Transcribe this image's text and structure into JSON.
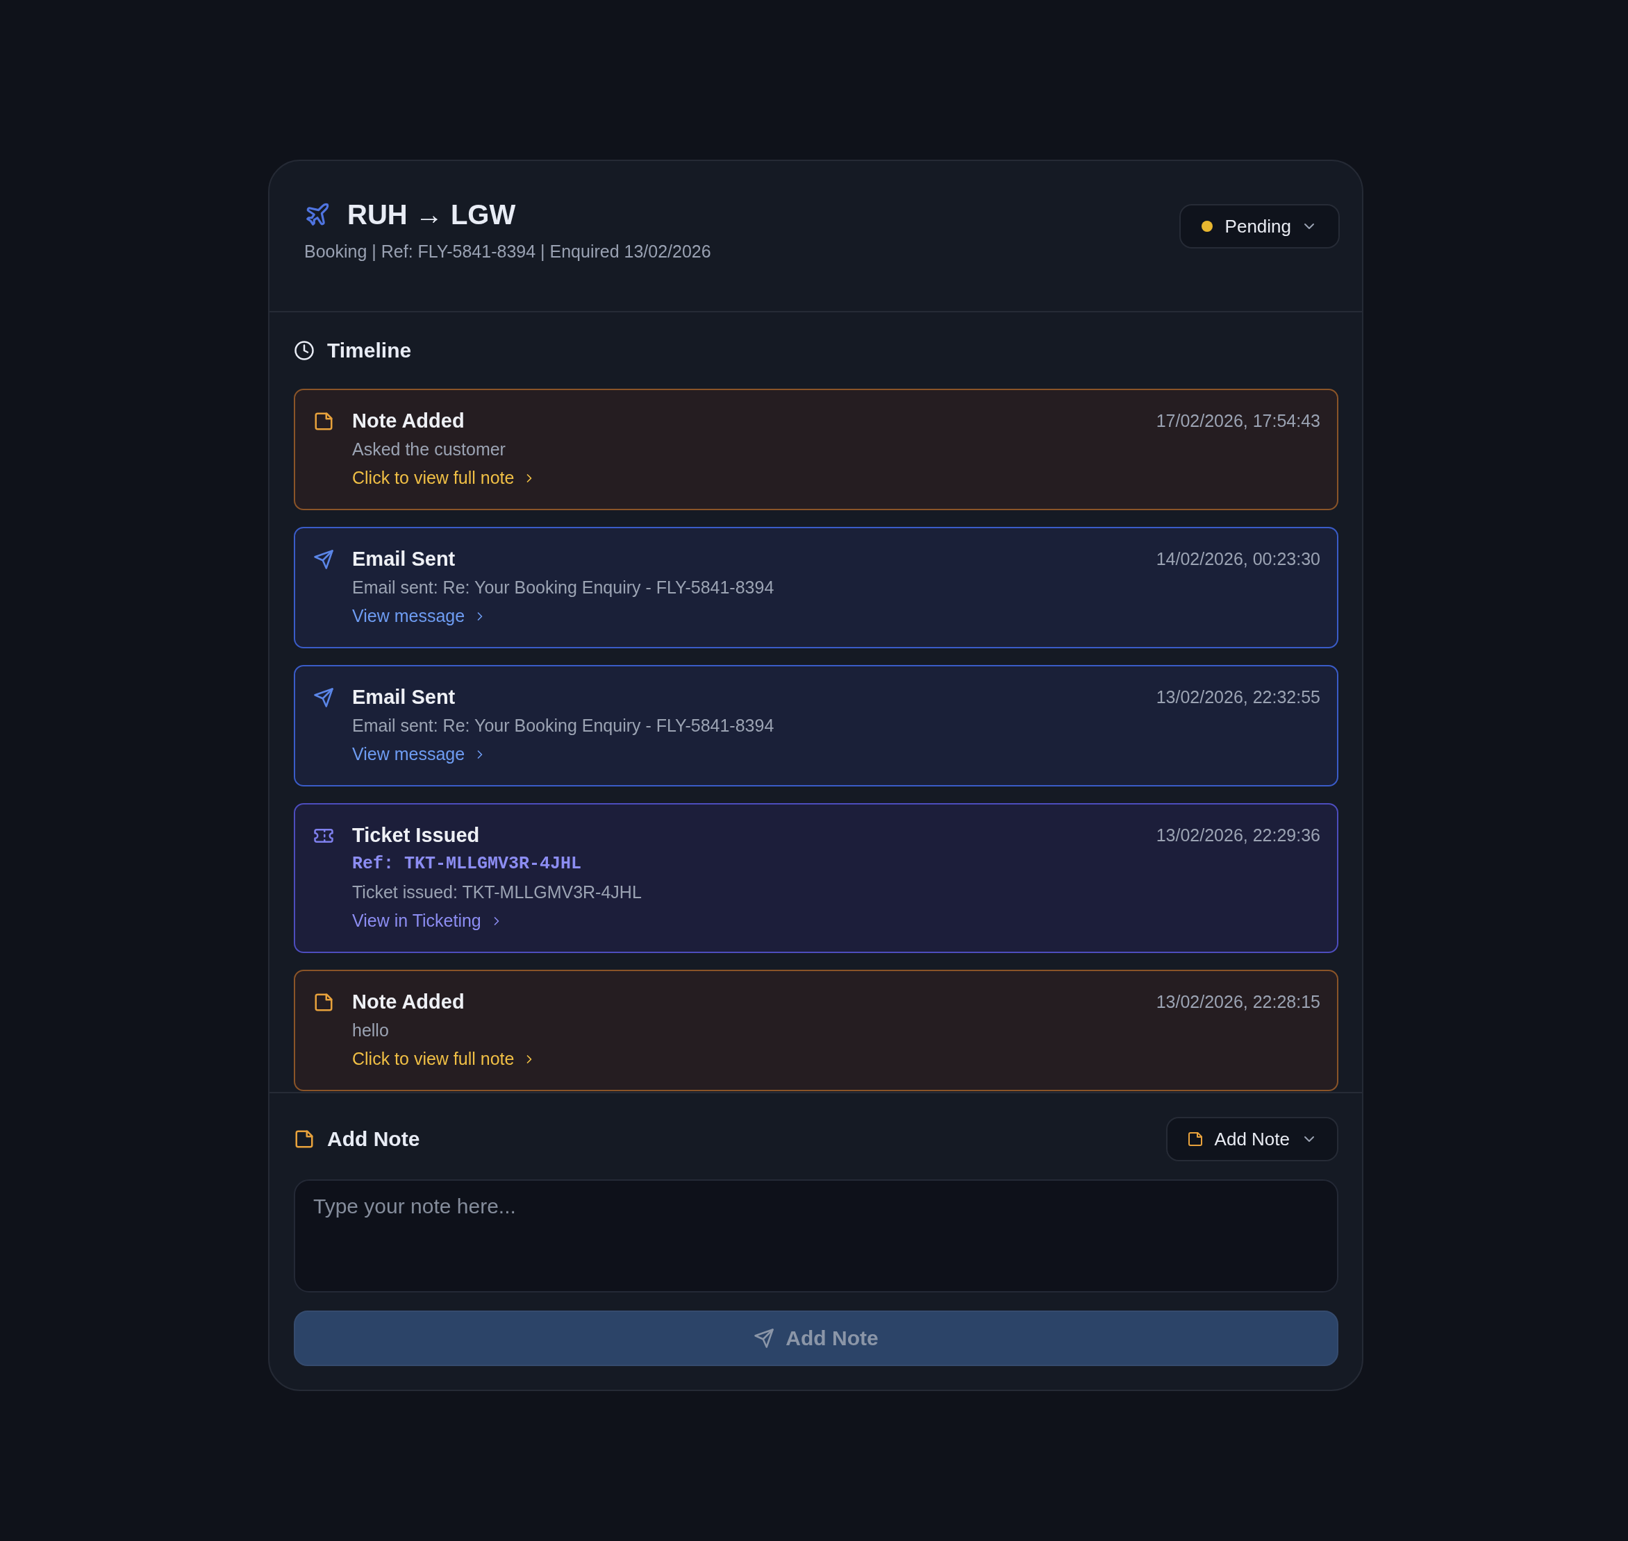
{
  "header": {
    "title": "RUH → LGW",
    "subtitle": "Booking | Ref: FLY-5841-8394 | Enquired 13/02/2026",
    "status": {
      "label": "Pending",
      "color": "#e8b730"
    }
  },
  "timeline": {
    "heading": "Timeline",
    "events": [
      {
        "kind": "note",
        "title": "Note Added",
        "time": "17/02/2026, 17:54:43",
        "text": "Asked the customer",
        "link": "Click to view full note"
      },
      {
        "kind": "email",
        "title": "Email Sent",
        "time": "14/02/2026, 00:23:30",
        "text": "Email sent: Re: Your Booking Enquiry - FLY-5841-8394",
        "link": "View message"
      },
      {
        "kind": "email",
        "title": "Email Sent",
        "time": "13/02/2026, 22:32:55",
        "text": "Email sent: Re: Your Booking Enquiry - FLY-5841-8394",
        "link": "View message"
      },
      {
        "kind": "ticket",
        "title": "Ticket Issued",
        "time": "13/02/2026, 22:29:36",
        "ref": "Ref: TKT-MLLGMV3R-4JHL",
        "text": "Ticket issued: TKT-MLLGMV3R-4JHL",
        "link": "View in Ticketing"
      },
      {
        "kind": "note",
        "title": "Note Added",
        "time": "13/02/2026, 22:28:15",
        "text": "hello",
        "link": "Click to view full note"
      }
    ]
  },
  "add_note": {
    "heading": "Add Note",
    "type_button": "Add Note",
    "placeholder": "Type your note here...",
    "submit": {
      "label": "Add Note",
      "disabled": true
    }
  }
}
